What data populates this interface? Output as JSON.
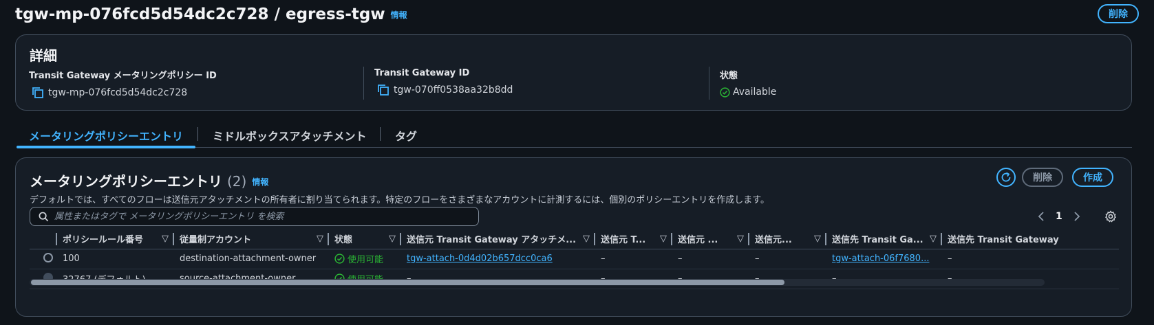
{
  "header": {
    "title": "tgw-mp-076fcd5d54dc2c728 / egress-tgw",
    "info_label": "情報",
    "delete_label": "削除"
  },
  "details": {
    "heading": "詳細",
    "policy_id_label": "Transit Gateway メータリングポリシー ID",
    "policy_id_value": "tgw-mp-076fcd5d54dc2c728",
    "tgw_id_label": "Transit Gateway ID",
    "tgw_id_value": "tgw-070ff0538aa32b8dd",
    "state_label": "状態",
    "state_value": "Available"
  },
  "tabs": [
    {
      "label": "メータリングポリシーエントリ",
      "active": true
    },
    {
      "label": "ミドルボックスアタッチメント",
      "active": false
    },
    {
      "label": "タグ",
      "active": false
    }
  ],
  "entries": {
    "title": "メータリングポリシーエントリ",
    "count": "(2)",
    "info_label": "情報",
    "description": "デフォルトでは、すべてのフローは送信元アタッチメントの所有者に割り当てられます。特定のフローをさまざまなアカウントに計測するには、個別のポリシーエントリを作成します。",
    "delete_label": "削除",
    "create_label": "作成",
    "search_placeholder": "属性またはタグで メータリングポリシーエントリ を検索",
    "page_number": "1",
    "columns": [
      "ポリシールール番号",
      "従量制アカウント",
      "状態",
      "送信元 Transit Gateway アタッチメ...",
      "送信元 T...",
      "送信元 ...",
      "送信元...",
      "送信先 Transit Ga...",
      "送信先 Transit Gateway"
    ],
    "rows": [
      {
        "rule_number": "100",
        "account": "destination-attachment-owner",
        "status": "使用可能",
        "src_attachment": "tgw-attach-0d4d02b657dcc0ca6",
        "src_t": "–",
        "src_2": "–",
        "src_3": "–",
        "dst_attachment": "tgw-attach-06f7680...",
        "dst_tgw": "–"
      },
      {
        "rule_number": "32767 (デフォルト)",
        "account": "source-attachment-owner",
        "status": "使用可能",
        "src_attachment": "–",
        "src_t": "–",
        "src_2": "–",
        "src_3": "–",
        "dst_attachment": "–",
        "dst_tgw": "–"
      }
    ]
  },
  "colors": {
    "accent": "#42b4ff",
    "success": "#2bb534",
    "background": "#0f141a",
    "card": "#161d26"
  }
}
